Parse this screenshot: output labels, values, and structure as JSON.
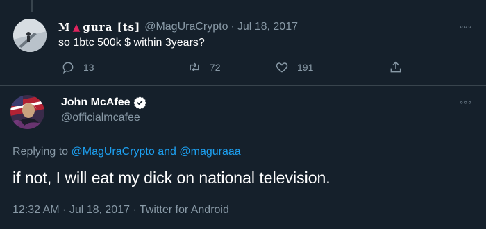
{
  "tweet1": {
    "display_name_parts": [
      "M",
      "▲",
      "gura [ts]"
    ],
    "handle": "@MagUraCrypto",
    "separator": "·",
    "date": "Jul 18, 2017",
    "text": "so 1btc 500k $ within 3years?",
    "more": "◦◦◦",
    "actions": {
      "reply_count": "13",
      "retweet_count": "72",
      "like_count": "191"
    },
    "icons": [
      "reply-icon",
      "retweet-icon",
      "like-icon",
      "share-icon"
    ]
  },
  "tweet2": {
    "display_name": "John McAfee",
    "verified": true,
    "handle": "@officialmcafee",
    "more": "◦◦◦",
    "replying_prefix": "Replying to",
    "replying_user1": "@MagUraCrypto",
    "replying_and": "and",
    "replying_user2": "@maguraaa",
    "text": "if not, I will eat my dick on national television.",
    "meta": "12:32 AM · Jul 18, 2017 · Twitter for Android"
  },
  "colors": {
    "background": "#15202b",
    "muted": "#8899a6",
    "accent": "#1da1f2",
    "divider": "#38444d",
    "triangle": "#e0245e"
  }
}
